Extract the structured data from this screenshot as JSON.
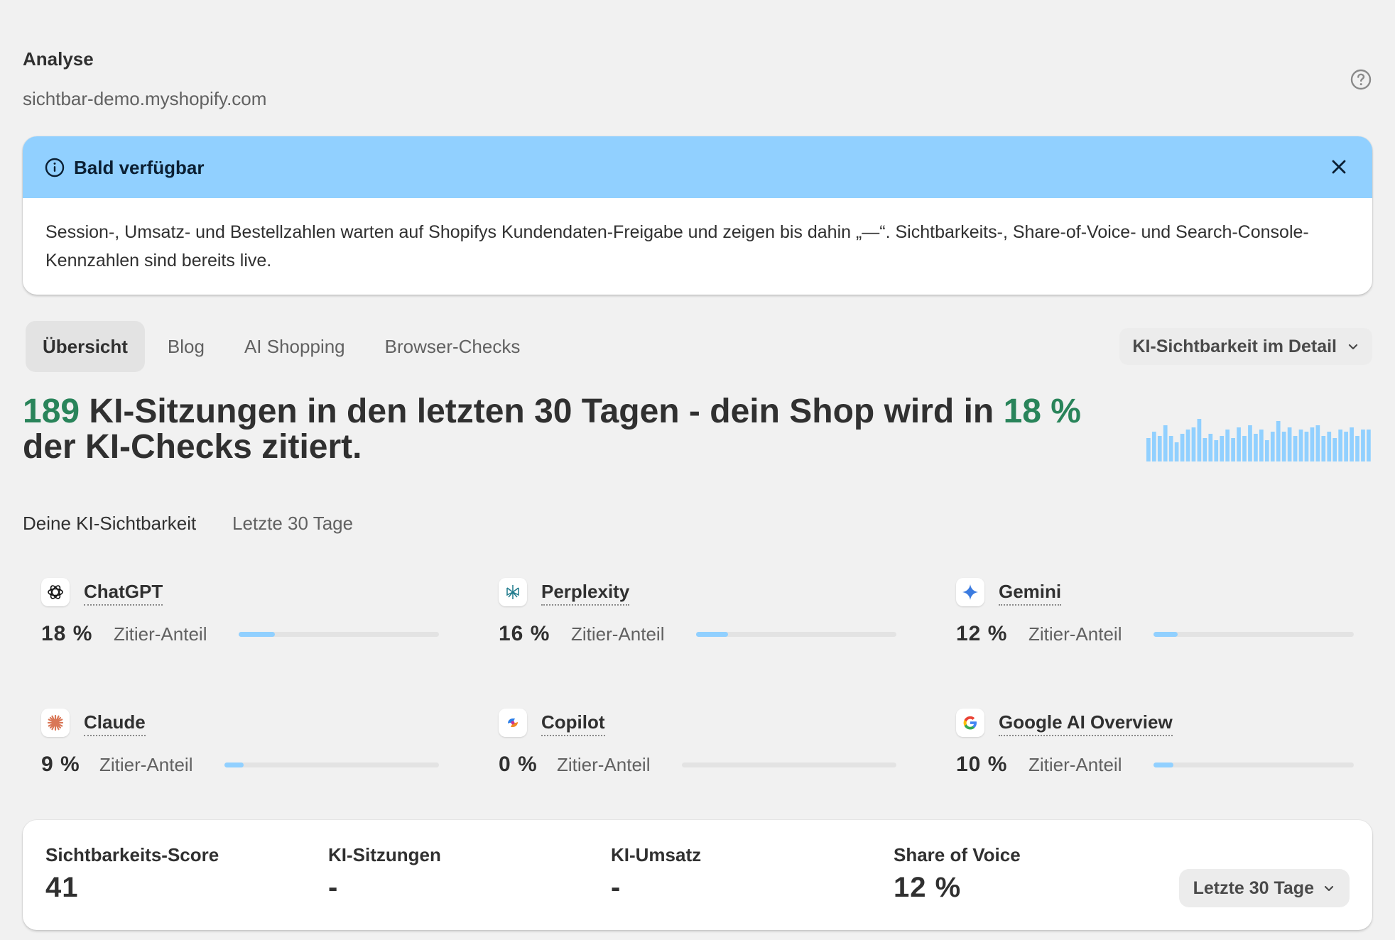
{
  "header": {
    "title": "Analyse",
    "subtitle": "sichtbar-demo.myshopify.com",
    "help_icon": "question-circle-icon"
  },
  "banner": {
    "title": "Bald verfügbar",
    "body": "Session-, Umsatz- und Bestellzahlen warten auf Shopifys Kundendaten-Freigabe und zeigen bis dahin „—“. Sichtbarkeits-, Share-of-Voice- und Search-Console-Kennzahlen sind bereits live.",
    "color": "#91d0ff"
  },
  "tabs": [
    {
      "label": "Übersicht",
      "active": true
    },
    {
      "label": "Blog",
      "active": false
    },
    {
      "label": "AI Shopping",
      "active": false
    },
    {
      "label": "Browser-Checks",
      "active": false
    }
  ],
  "detail_menu": {
    "label": "KI-Sichtbarkeit im Detail"
  },
  "headline": {
    "sessions": "189",
    "part1": " KI-Sitzungen in den letzten 30 Tagen - dein Shop wird in ",
    "percent": "18 %",
    "part2": " der KI-Checks zitiert.",
    "accent_color": "#29845a"
  },
  "sparkline_values": [
    0.55,
    0.7,
    0.6,
    0.85,
    0.6,
    0.45,
    0.65,
    0.75,
    0.8,
    1.0,
    0.55,
    0.65,
    0.5,
    0.6,
    0.75,
    0.55,
    0.8,
    0.6,
    0.85,
    0.65,
    0.75,
    0.5,
    0.7,
    0.95,
    0.7,
    0.8,
    0.6,
    0.75,
    0.7,
    0.8,
    0.85,
    0.6,
    0.7,
    0.55,
    0.75,
    0.7,
    0.8,
    0.6,
    0.75,
    0.75
  ],
  "visibility": {
    "title": "Deine KI-Sichtbarkeit",
    "period": "Letzte 30 Tage",
    "metric_label": "Zitier-Anteil",
    "engines": [
      {
        "name": "ChatGPT",
        "pct": "18 %",
        "share": 0.18,
        "icon": "chatgpt-icon"
      },
      {
        "name": "Perplexity",
        "pct": "16 %",
        "share": 0.16,
        "icon": "perplexity-icon"
      },
      {
        "name": "Gemini",
        "pct": "12 %",
        "share": 0.12,
        "icon": "gemini-icon"
      },
      {
        "name": "Claude",
        "pct": "9 %",
        "share": 0.09,
        "icon": "claude-icon"
      },
      {
        "name": "Copilot",
        "pct": "0 %",
        "share": 0.0,
        "icon": "copilot-icon"
      },
      {
        "name": "Google AI Overview",
        "pct": "10 %",
        "share": 0.1,
        "icon": "google-icon"
      }
    ]
  },
  "stats": [
    {
      "label": "Sichtbarkeits-Score",
      "value": "41"
    },
    {
      "label": "KI-Sitzungen",
      "value": "-"
    },
    {
      "label": "KI-Umsatz",
      "value": "-"
    },
    {
      "label": "Share of Voice",
      "value": "12 %"
    }
  ],
  "range_menu": {
    "label": "Letzte 30 Tage"
  }
}
